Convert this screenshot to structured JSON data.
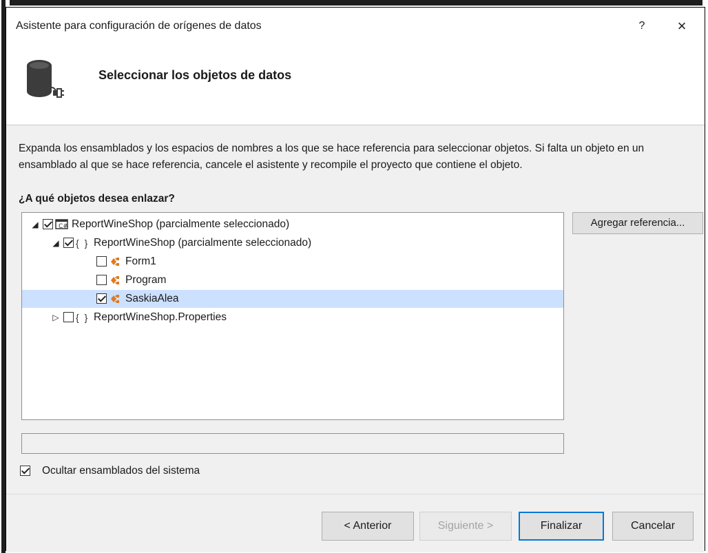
{
  "window": {
    "title": "Asistente para configuración de orígenes de datos",
    "help_label": "?",
    "close_label": "×"
  },
  "header": {
    "title": "Seleccionar los objetos de datos",
    "icon": "database-connection-icon"
  },
  "body": {
    "description": "Expanda los ensamblados y los espacios de nombres a los que se hace referencia para seleccionar objetos. Si falta un objeto en un ensamblado al que se hace referencia, cancele el asistente y recompile el proyecto que contiene el objeto.",
    "question": "¿A qué objetos desea enlazar?",
    "tree": [
      {
        "label": "ReportWineShop (parcialmente seleccionado)",
        "level": 0,
        "expander": "◢",
        "checked": true,
        "icon": "project-icon"
      },
      {
        "label": "ReportWineShop (parcialmente seleccionado)",
        "level": 1,
        "expander": "◢",
        "checked": true,
        "icon": "namespace-icon",
        "icon_text": "{ }"
      },
      {
        "label": "Form1",
        "level": 2,
        "expander": "",
        "checked": false,
        "icon": "class-icon"
      },
      {
        "label": "Program",
        "level": 2,
        "expander": "",
        "checked": false,
        "icon": "class-icon"
      },
      {
        "label": "SaskiaAlea",
        "level": 2,
        "expander": "",
        "checked": true,
        "icon": "class-icon",
        "selected": true
      },
      {
        "label": "ReportWineShop.Properties",
        "level": 1,
        "expander": "▷",
        "checked": false,
        "icon": "namespace-icon",
        "icon_text": "{ }"
      }
    ],
    "add_reference_label": "Agregar referencia...",
    "hide_system_label": "Ocultar ensamblados del sistema",
    "hide_system_checked": true
  },
  "footer": {
    "back_label": "< Anterior",
    "next_label": "Siguiente >",
    "finish_label": "Finalizar",
    "cancel_label": "Cancelar"
  },
  "colors": {
    "selection": "#cce0ff",
    "accent": "#0078d7",
    "icon_orange": "#e07a1f"
  }
}
